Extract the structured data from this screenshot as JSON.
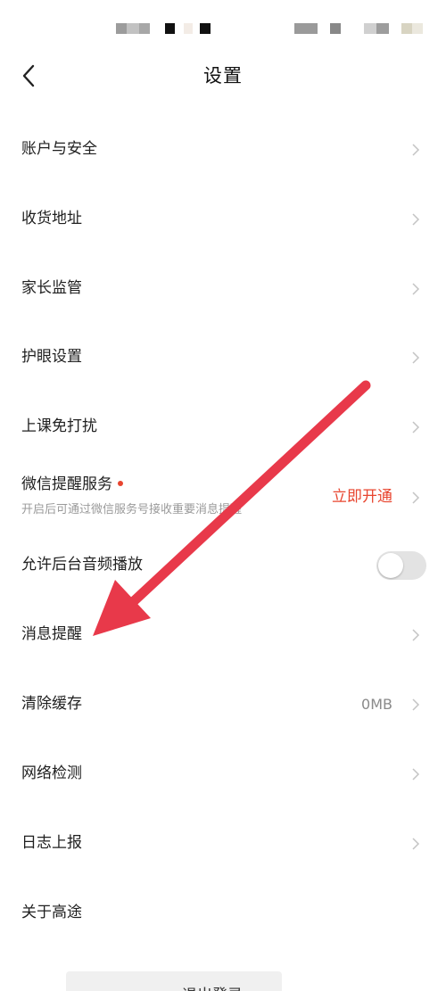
{
  "header": {
    "title": "设置",
    "back_icon": "chevron-left-icon"
  },
  "settings": {
    "account_security": "账户与安全",
    "shipping_address": "收货地址",
    "parental_control": "家长监管",
    "eye_protection": "护眼设置",
    "class_do_not_disturb": "上课免打扰",
    "wechat_reminder": {
      "label": "微信提醒服务",
      "subtitle": "开启后可通过微信服务号接收重要消息提醒",
      "action": "立即开通"
    },
    "background_audio": {
      "label": "允许后台音频播放",
      "enabled": false
    },
    "message_reminder": "消息提醒",
    "clear_cache": {
      "label": "清除缓存",
      "value": "0MB"
    },
    "network_check": "网络检测",
    "log_report": "日志上报",
    "about": "关于高途"
  },
  "logout": {
    "label": "退出登录"
  },
  "colors": {
    "accent_red": "#e8452f",
    "annotation_arrow": "#e8394a",
    "chevron_gray": "#c4c4c4"
  }
}
